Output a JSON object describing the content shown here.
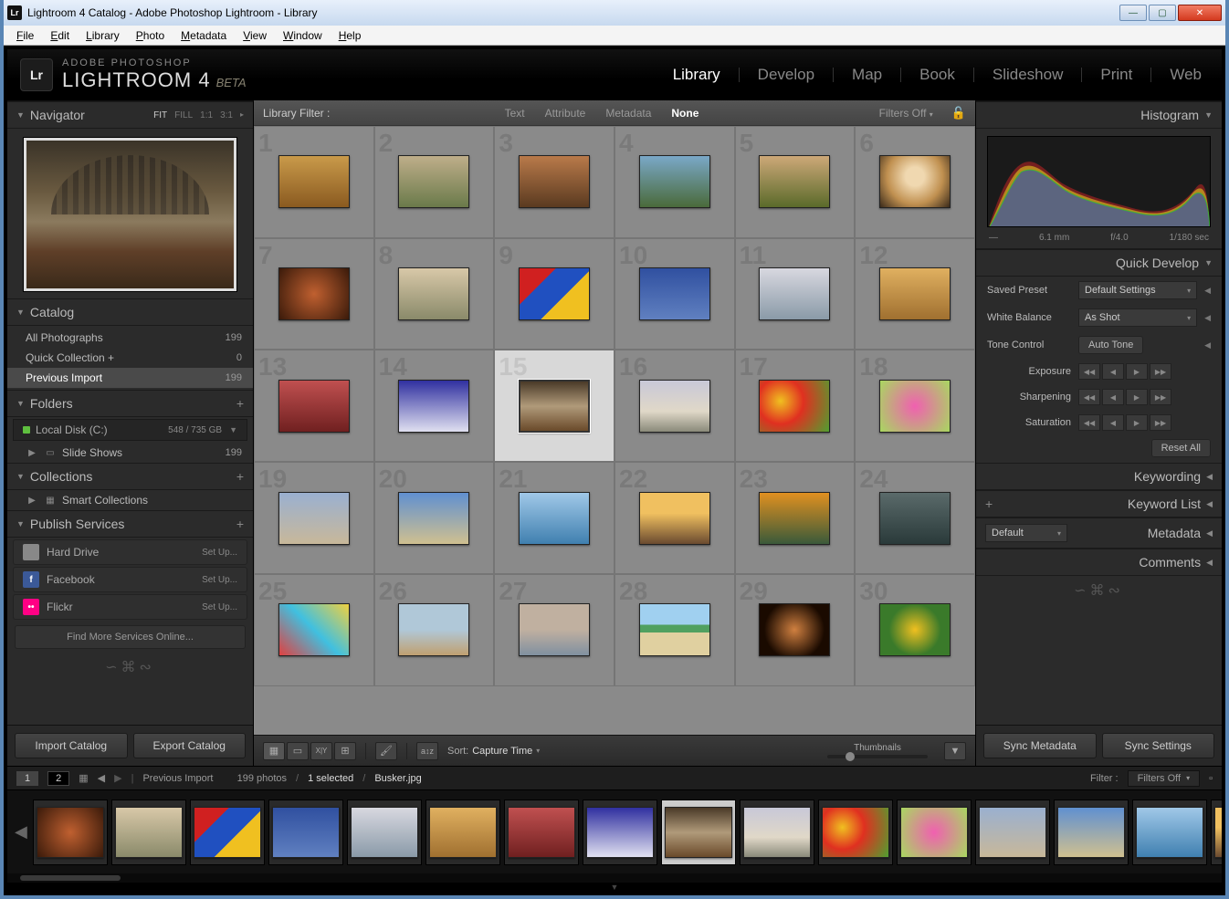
{
  "window": {
    "title": "Lightroom 4 Catalog - Adobe Photoshop Lightroom - Library"
  },
  "menubar": [
    "File",
    "Edit",
    "Library",
    "Photo",
    "Metadata",
    "View",
    "Window",
    "Help"
  ],
  "identity": {
    "brand_top": "ADOBE PHOTOSHOP",
    "brand_main": "LIGHTROOM 4",
    "suffix": "BETA"
  },
  "modules": [
    "Library",
    "Develop",
    "Map",
    "Book",
    "Slideshow",
    "Print",
    "Web"
  ],
  "active_module": "Library",
  "navigator": {
    "title": "Navigator",
    "opts": [
      "FIT",
      "FILL",
      "1:1",
      "3:1"
    ],
    "active": "FIT"
  },
  "catalog": {
    "title": "Catalog",
    "items": [
      {
        "label": "All Photographs",
        "count": "199"
      },
      {
        "label": "Quick Collection  +",
        "count": "0"
      },
      {
        "label": "Previous Import",
        "count": "199"
      }
    ],
    "selected": 2
  },
  "folders": {
    "title": "Folders",
    "disk": {
      "label": "Local Disk (C:)",
      "stat": "548 / 735 GB"
    },
    "items": [
      {
        "label": "Slide Shows",
        "count": "199"
      }
    ]
  },
  "collections": {
    "title": "Collections",
    "items": [
      {
        "label": "Smart Collections"
      }
    ]
  },
  "publish": {
    "title": "Publish Services",
    "items": [
      {
        "label": "Hard Drive",
        "btn": "Set Up...",
        "color": "#888"
      },
      {
        "label": "Facebook",
        "btn": "Set Up...",
        "color": "#3b5998",
        "glyph": "f"
      },
      {
        "label": "Flickr",
        "btn": "Set Up...",
        "color": "#ff0084",
        "glyph": "••"
      }
    ],
    "find_more": "Find More Services Online..."
  },
  "left_btns": {
    "import": "Import Catalog",
    "export": "Export Catalog"
  },
  "lib_filter": {
    "label": "Library Filter :",
    "opts": [
      "Text",
      "Attribute",
      "Metadata",
      "None"
    ],
    "active": "None",
    "filters_off": "Filters Off"
  },
  "grid": {
    "selected": 15,
    "cells": [
      1,
      2,
      3,
      4,
      5,
      6,
      7,
      8,
      9,
      10,
      11,
      12,
      13,
      14,
      15,
      16,
      17,
      18,
      19,
      20,
      21,
      22,
      23,
      24,
      25,
      26,
      27,
      28,
      29,
      30
    ]
  },
  "toolbar": {
    "sort_label": "Sort:",
    "sort_value": "Capture Time",
    "thumbs_label": "Thumbnails"
  },
  "right": {
    "histogram": {
      "title": "Histogram",
      "focal": "6.1 mm",
      "aperture": "f/4.0",
      "shutter": "1/180 sec",
      "iso": "—"
    },
    "quick_dev": {
      "title": "Quick Develop",
      "preset_lbl": "Saved Preset",
      "preset_val": "Default Settings",
      "wb_lbl": "White Balance",
      "wb_val": "As Shot",
      "tone_lbl": "Tone Control",
      "tone_btn": "Auto Tone",
      "exposure": "Exposure",
      "sharpening": "Sharpening",
      "saturation": "Saturation",
      "reset": "Reset All"
    },
    "keywording": "Keywording",
    "keyword_list": "Keyword List",
    "metadata": {
      "title": "Metadata",
      "preset": "Default"
    },
    "comments": "Comments",
    "sync_meta": "Sync Metadata",
    "sync_set": "Sync Settings"
  },
  "filmstrip": {
    "screens": [
      "1",
      "2"
    ],
    "path_label": "Previous Import",
    "count": "199 photos",
    "selected": "1 selected",
    "filename": "Busker.jpg",
    "filter_lbl": "Filter :",
    "filter_val": "Filters Off",
    "thumbs": [
      7,
      8,
      9,
      10,
      11,
      12,
      13,
      14,
      15,
      16,
      17,
      18,
      19,
      20,
      21,
      22,
      23
    ],
    "selected_thumb": 15
  }
}
